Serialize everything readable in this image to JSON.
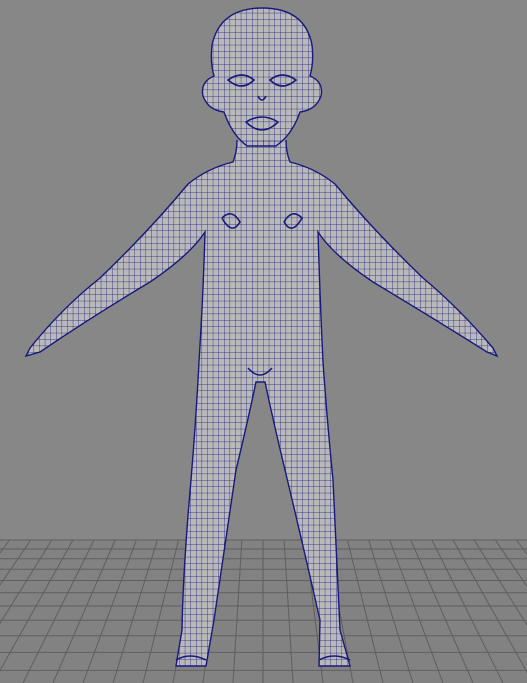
{
  "viewport": {
    "background_color": "#878787",
    "grid_color": "#5f5f5f",
    "grid_floor_color": "#828282"
  },
  "model": {
    "fill_color": "#b9b9b9",
    "wire_color": "#19197d",
    "pose": "a-pose",
    "display_mode": "wireframe-on-shaded"
  }
}
